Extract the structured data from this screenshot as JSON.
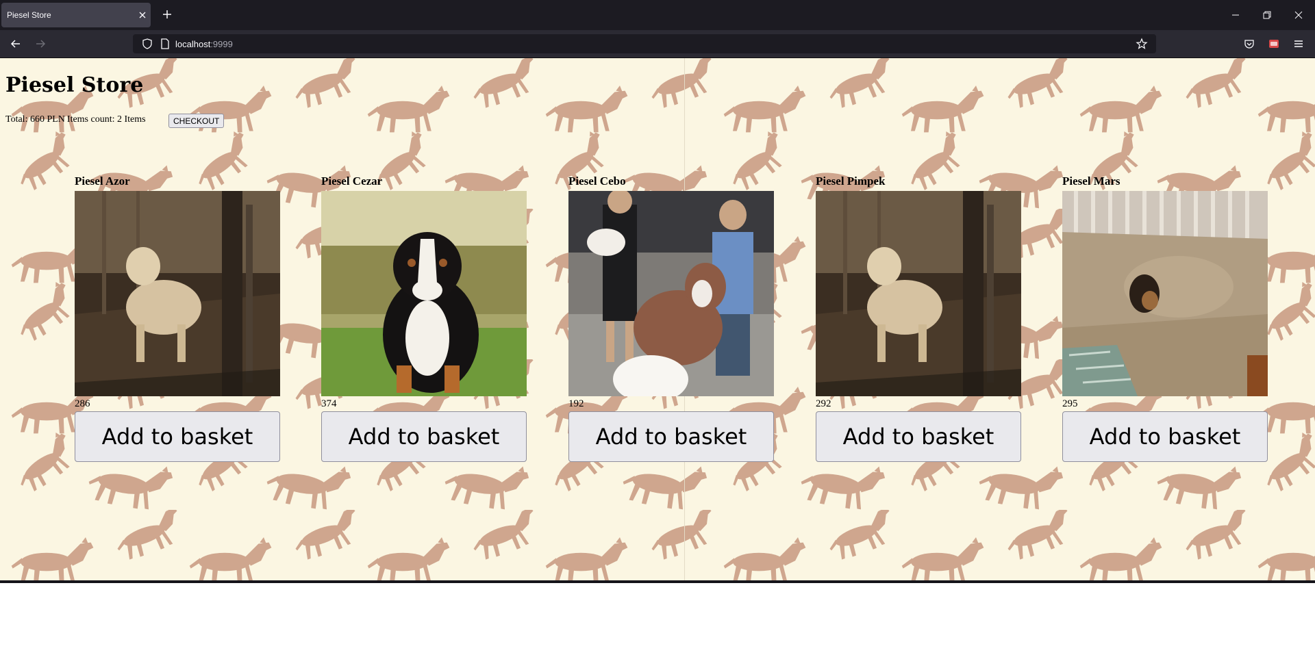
{
  "browser": {
    "tab_title": "Piesel Store",
    "url_host": "localhost",
    "url_port": ":9999"
  },
  "page": {
    "title": "Piesel Store",
    "total_text": "Total: 660 PLN",
    "items_count_text": "Items count: 2 Items",
    "checkout_label": "CHECKOUT"
  },
  "products": [
    {
      "name": "Piesel Azor",
      "price": "286",
      "button": "Add to basket"
    },
    {
      "name": "Piesel Cezar",
      "price": "374",
      "button": "Add to basket"
    },
    {
      "name": "Piesel Cebo",
      "price": "192",
      "button": "Add to basket"
    },
    {
      "name": "Piesel Pimpek",
      "price": "292",
      "button": "Add to basket"
    },
    {
      "name": "Piesel Mars",
      "price": "295",
      "button": "Add to basket"
    }
  ],
  "icons": {
    "tab_close": "close-icon",
    "new_tab": "plus-icon",
    "back": "arrow-left-icon",
    "forward": "arrow-right-icon",
    "shield": "shield-icon",
    "page": "page-icon",
    "bookmark": "star-icon",
    "pocket": "pocket-icon",
    "extension": "extension-icon",
    "menu": "hamburger-icon",
    "minimize": "minimize-icon",
    "restore": "restore-icon",
    "close_window": "close-window-icon"
  },
  "colors": {
    "page_background": "#fbf6e2",
    "pattern_dog": "#cfa68e",
    "browser_dark": "#1c1b22",
    "button_bg": "#e9e9ed"
  }
}
